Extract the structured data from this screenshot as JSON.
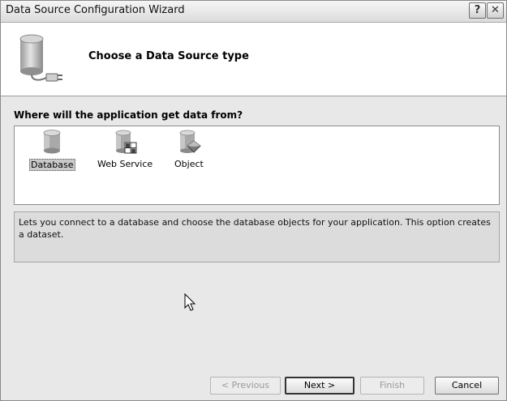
{
  "window": {
    "title": "Data Source Configuration Wizard",
    "help_label": "?",
    "close_label": "✕"
  },
  "header": {
    "title": "Choose a Data Source type",
    "icon": "database-connector-icon"
  },
  "main": {
    "question": "Where will the application get data from?",
    "sources": [
      {
        "label": "Database",
        "icon": "database-icon",
        "selected": true
      },
      {
        "label": "Web Service",
        "icon": "web-service-icon",
        "selected": false
      },
      {
        "label": "Object",
        "icon": "object-icon",
        "selected": false
      }
    ],
    "description": "Lets you connect to a database and choose the database objects for your application. This option creates a dataset."
  },
  "buttons": {
    "previous": "< Previous",
    "next": "Next >",
    "finish": "Finish",
    "cancel": "Cancel"
  }
}
